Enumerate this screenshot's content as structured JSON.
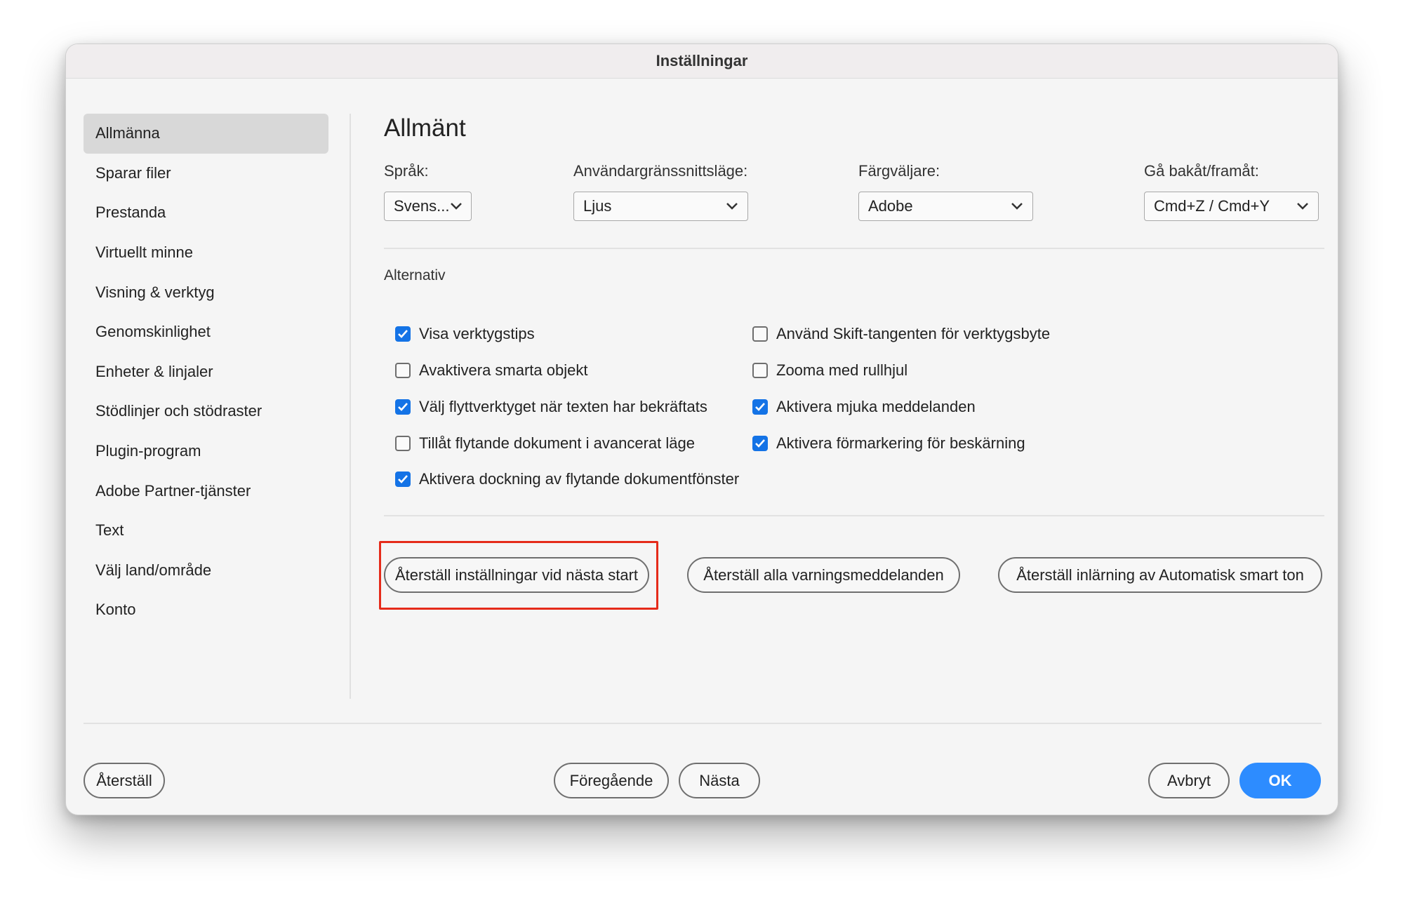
{
  "window": {
    "title": "Inställningar"
  },
  "sidebar": {
    "items": [
      {
        "label": "Allmänna",
        "active": true
      },
      {
        "label": "Sparar filer"
      },
      {
        "label": "Prestanda"
      },
      {
        "label": "Virtuellt minne"
      },
      {
        "label": "Visning & verktyg"
      },
      {
        "label": "Genomskinlighet"
      },
      {
        "label": "Enheter & linjaler"
      },
      {
        "label": "Stödlinjer och stödraster"
      },
      {
        "label": "Plugin-program"
      },
      {
        "label": "Adobe Partner-tjänster"
      },
      {
        "label": "Text"
      },
      {
        "label": "Välj land/område"
      },
      {
        "label": "Konto"
      }
    ]
  },
  "main": {
    "title": "Allmänt",
    "fields": [
      {
        "label": "Språk:",
        "value": "Svens..."
      },
      {
        "label": "Användargränssnittsläge:",
        "value": "Ljus"
      },
      {
        "label": "Färgväljare:",
        "value": "Adobe"
      },
      {
        "label": "Gå bakåt/framåt:",
        "value": "Cmd+Z / Cmd+Y"
      }
    ],
    "options_label": "Alternativ",
    "options_left": [
      {
        "label": "Visa verktygstips",
        "checked": true
      },
      {
        "label": "Avaktivera smarta objekt",
        "checked": false
      },
      {
        "label": "Välj flyttverktyget när texten har bekräftats",
        "checked": true
      },
      {
        "label": "Tillåt flytande dokument i avancerat läge",
        "checked": false
      },
      {
        "label": "Aktivera dockning av flytande dokumentfönster",
        "checked": true
      }
    ],
    "options_right": [
      {
        "label": "Använd Skift-tangenten för verktygsbyte",
        "checked": false
      },
      {
        "label": "Zooma med rullhjul",
        "checked": false
      },
      {
        "label": "Aktivera mjuka meddelanden",
        "checked": true
      },
      {
        "label": "Aktivera förmarkering för beskärning",
        "checked": true
      }
    ],
    "reset_buttons": [
      "Återställ inställningar vid nästa start",
      "Återställ alla varningsmeddelanden",
      "Återställ inlärning av Automatisk smart ton"
    ]
  },
  "footer": {
    "reset": "Återställ",
    "previous": "Föregående",
    "next": "Nästa",
    "cancel": "Avbryt",
    "ok": "OK"
  },
  "colors": {
    "accent": "#1473e6",
    "ok_button": "#2d8cff",
    "highlight": "#e52b1a"
  }
}
